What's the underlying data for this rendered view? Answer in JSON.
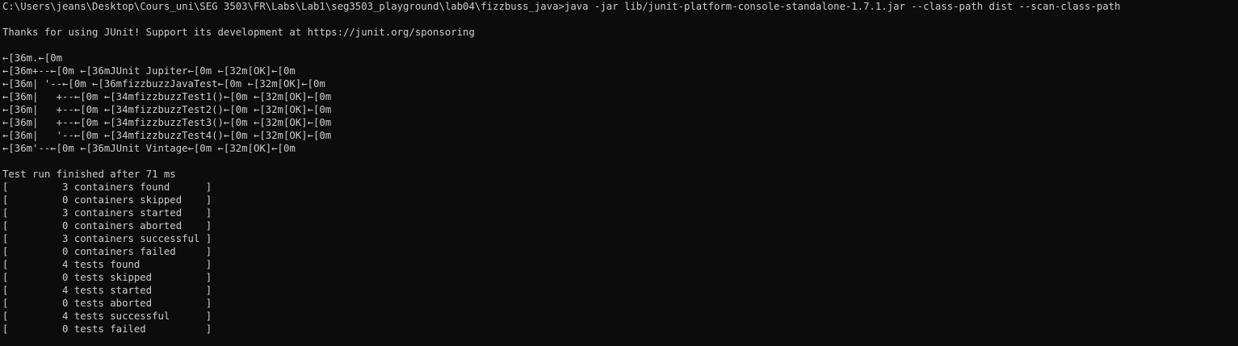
{
  "terminal": {
    "lines": [
      "C:\\Users\\jeans\\Desktop\\Cours_uni\\SEG 3503\\FR\\Labs\\Lab1\\seg3503_playground\\lab04\\fizzbuss_java>java -jar lib/junit-platform-console-standalone-1.7.1.jar --class-path dist --scan-class-path",
      "",
      "Thanks for using JUnit! Support its development at https://junit.org/sponsoring",
      "",
      "←[36m.←[0m",
      "←[36m+--←[0m ←[36mJUnit Jupiter←[0m ←[32m[OK]←[0m",
      "←[36m| '--←[0m ←[36mfizzbuzzJavaTest←[0m ←[32m[OK]←[0m",
      "←[36m|   +--←[0m ←[34mfizzbuzzTest1()←[0m ←[32m[OK]←[0m",
      "←[36m|   +--←[0m ←[34mfizzbuzzTest2()←[0m ←[32m[OK]←[0m",
      "←[36m|   +--←[0m ←[34mfizzbuzzTest3()←[0m ←[32m[OK]←[0m",
      "←[36m|   '--←[0m ←[34mfizzbuzzTest4()←[0m ←[32m[OK]←[0m",
      "←[36m'--←[0m ←[36mJUnit Vintage←[0m ←[32m[OK]←[0m",
      "",
      "Test run finished after 71 ms",
      "[         3 containers found      ]",
      "[         0 containers skipped    ]",
      "[         3 containers started    ]",
      "[         0 containers aborted    ]",
      "[         3 containers successful ]",
      "[         0 containers failed     ]",
      "[         4 tests found           ]",
      "[         0 tests skipped         ]",
      "[         4 tests started         ]",
      "[         0 tests aborted         ]",
      "[         4 tests successful      ]",
      "[         0 tests failed          ]"
    ]
  },
  "colors": {
    "background": "#0c0c0c",
    "foreground": "#cccccc"
  }
}
